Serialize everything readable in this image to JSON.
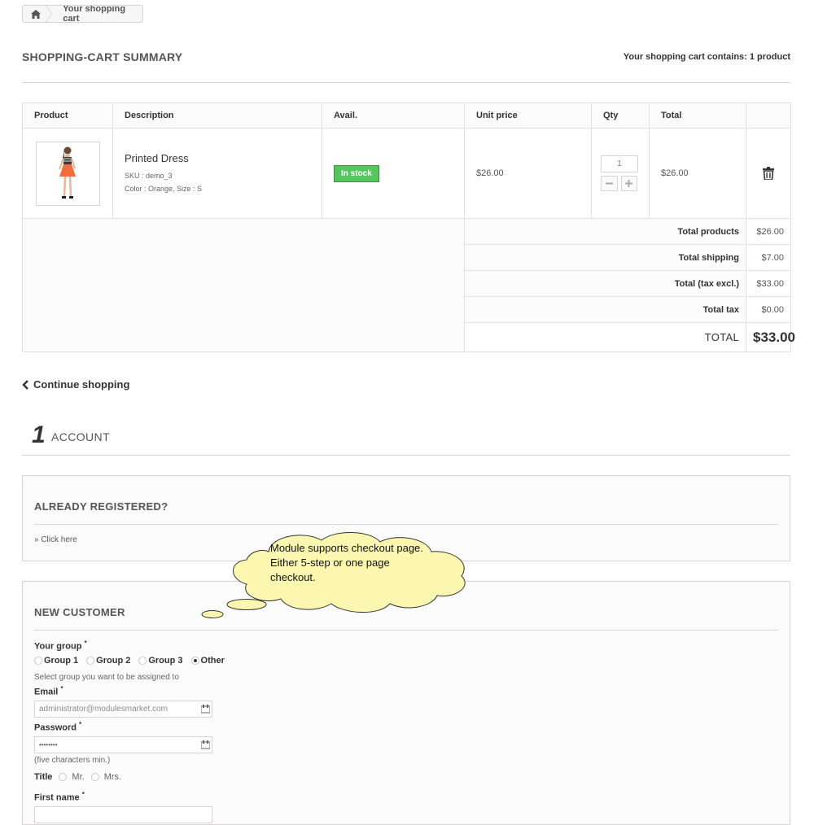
{
  "breadcrumb": {
    "current": "Your shopping cart"
  },
  "header": {
    "title": "SHOPPING-CART SUMMARY",
    "cart_contains": "Your shopping cart contains: 1 product"
  },
  "cart": {
    "columns": [
      "Product",
      "Description",
      "Avail.",
      "Unit price",
      "Qty",
      "Total"
    ],
    "item": {
      "name": "Printed Dress",
      "sku": "SKU : demo_3",
      "attributes": "Color : Orange, Size : S",
      "availability": "In stock",
      "unit_price": "$26.00",
      "qty": "1",
      "total": "$26.00"
    },
    "totals": [
      {
        "label": "Total products",
        "value": "$26.00"
      },
      {
        "label": "Total shipping",
        "value": "$7.00"
      },
      {
        "label": "Total (tax excl.)",
        "value": "$33.00"
      },
      {
        "label": "Total tax",
        "value": "$0.00"
      }
    ],
    "grand_total": {
      "label": "TOTAL",
      "value": "$33.00"
    }
  },
  "continue_shopping": "Continue shopping",
  "step": {
    "number": "1",
    "title": "ACCOUNT"
  },
  "registered": {
    "title": "ALREADY REGISTERED?",
    "link": "» Click here"
  },
  "callout": {
    "text": "Module supports checkout page. Either 5-step or one page checkout."
  },
  "new_customer": {
    "title": "NEW CUSTOMER",
    "group_label": "Your group",
    "groups": [
      "Group 1",
      "Group 2",
      "Group 3",
      "Other"
    ],
    "selected_group": "Other",
    "group_help": "Select group you want to be assigned to",
    "email_label": "Email",
    "email_value": "administrator@modulesmarket.com",
    "password_label": "Password",
    "password_value": "••••••••",
    "password_help": "(five characters min.)",
    "title_label": "Title",
    "title_options": [
      "Mr.",
      "Mrs."
    ],
    "first_name_label": "First name",
    "required_mark": "*"
  },
  "colors": {
    "in_stock": "#55c65e",
    "border": "#d6d4d4",
    "callout_fill": "#fbf7b1"
  }
}
